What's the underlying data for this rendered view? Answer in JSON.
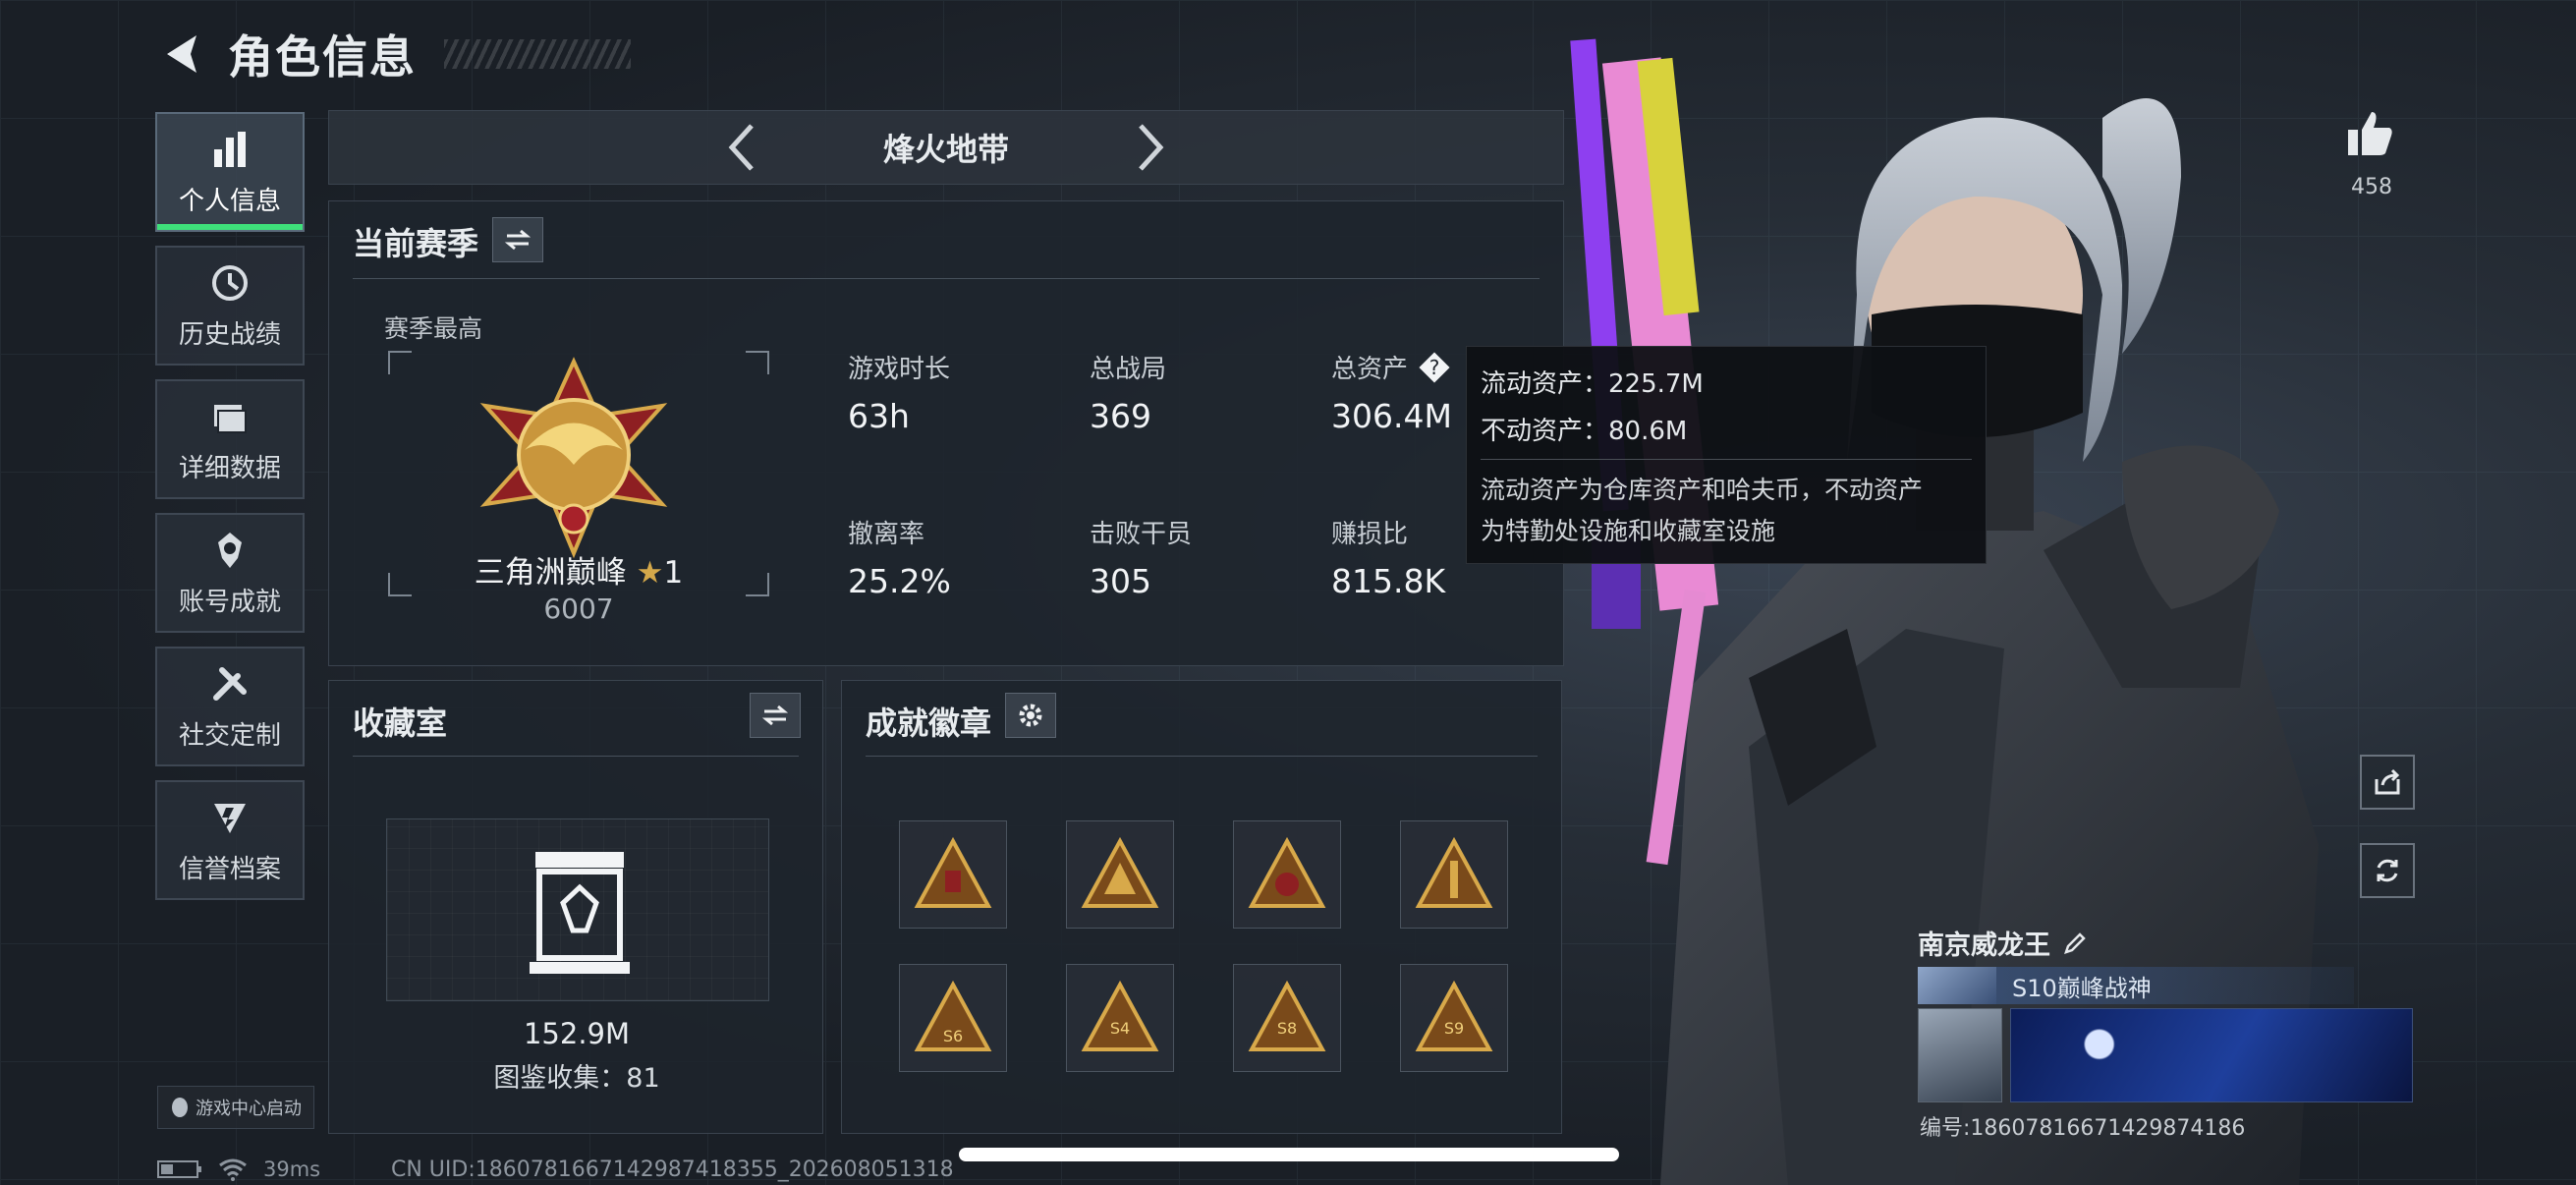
{
  "header": {
    "title": "角色信息"
  },
  "sidebar": {
    "items": [
      {
        "label": "个人信息",
        "icon": "bar-chart-icon",
        "active": true
      },
      {
        "label": "历史战绩",
        "icon": "history-icon"
      },
      {
        "label": "详细数据",
        "icon": "folder-icon"
      },
      {
        "label": "账号成就",
        "icon": "achievement-icon"
      },
      {
        "label": "社交定制",
        "icon": "tools-icon"
      },
      {
        "label": "信誉档案",
        "icon": "credit-shield-icon"
      }
    ],
    "launch_label": "游戏中心启动"
  },
  "mode": {
    "name": "烽火地带"
  },
  "season": {
    "title": "当前赛季",
    "best_label": "赛季最高",
    "rank_name": "三角洲巅峰",
    "rank_star": "★",
    "rank_stars": "1",
    "rank_points": "6007",
    "stats": [
      {
        "label": "游戏时长",
        "value": "63h"
      },
      {
        "label": "总战局",
        "value": "369"
      },
      {
        "label": "总资产",
        "value": "306.4M"
      },
      {
        "label": "撤离率",
        "value": "25.2%"
      },
      {
        "label": "击败干员",
        "value": "305"
      },
      {
        "label": "赚损比",
        "value": "815.8K"
      }
    ]
  },
  "tooltip": {
    "liquid": "流动资产：225.7M",
    "fixed": "不动资产：80.6M",
    "desc1": "流动资产为仓库资产和哈夫币，不动资产",
    "desc2": "为特勤处设施和收藏室设施"
  },
  "collection": {
    "title": "收藏室",
    "value": "152.9M",
    "count": "图鉴收集：81"
  },
  "badges": {
    "title": "成就徽章",
    "medals": [
      "",
      "",
      "",
      "",
      "S6",
      "S4",
      "S8",
      "S9"
    ]
  },
  "social": {
    "likes": "458"
  },
  "profile": {
    "name": "南京威龙王",
    "title": "S10巅峰战神",
    "id": "编号:18607816671429874186"
  },
  "status": {
    "ping": "39ms",
    "uid": "CN UID:1860781667142987418355_202608051318"
  },
  "colors": {
    "accent_green": "#3ee07a",
    "gold": "#c9963c",
    "panel": "#1e242c"
  }
}
